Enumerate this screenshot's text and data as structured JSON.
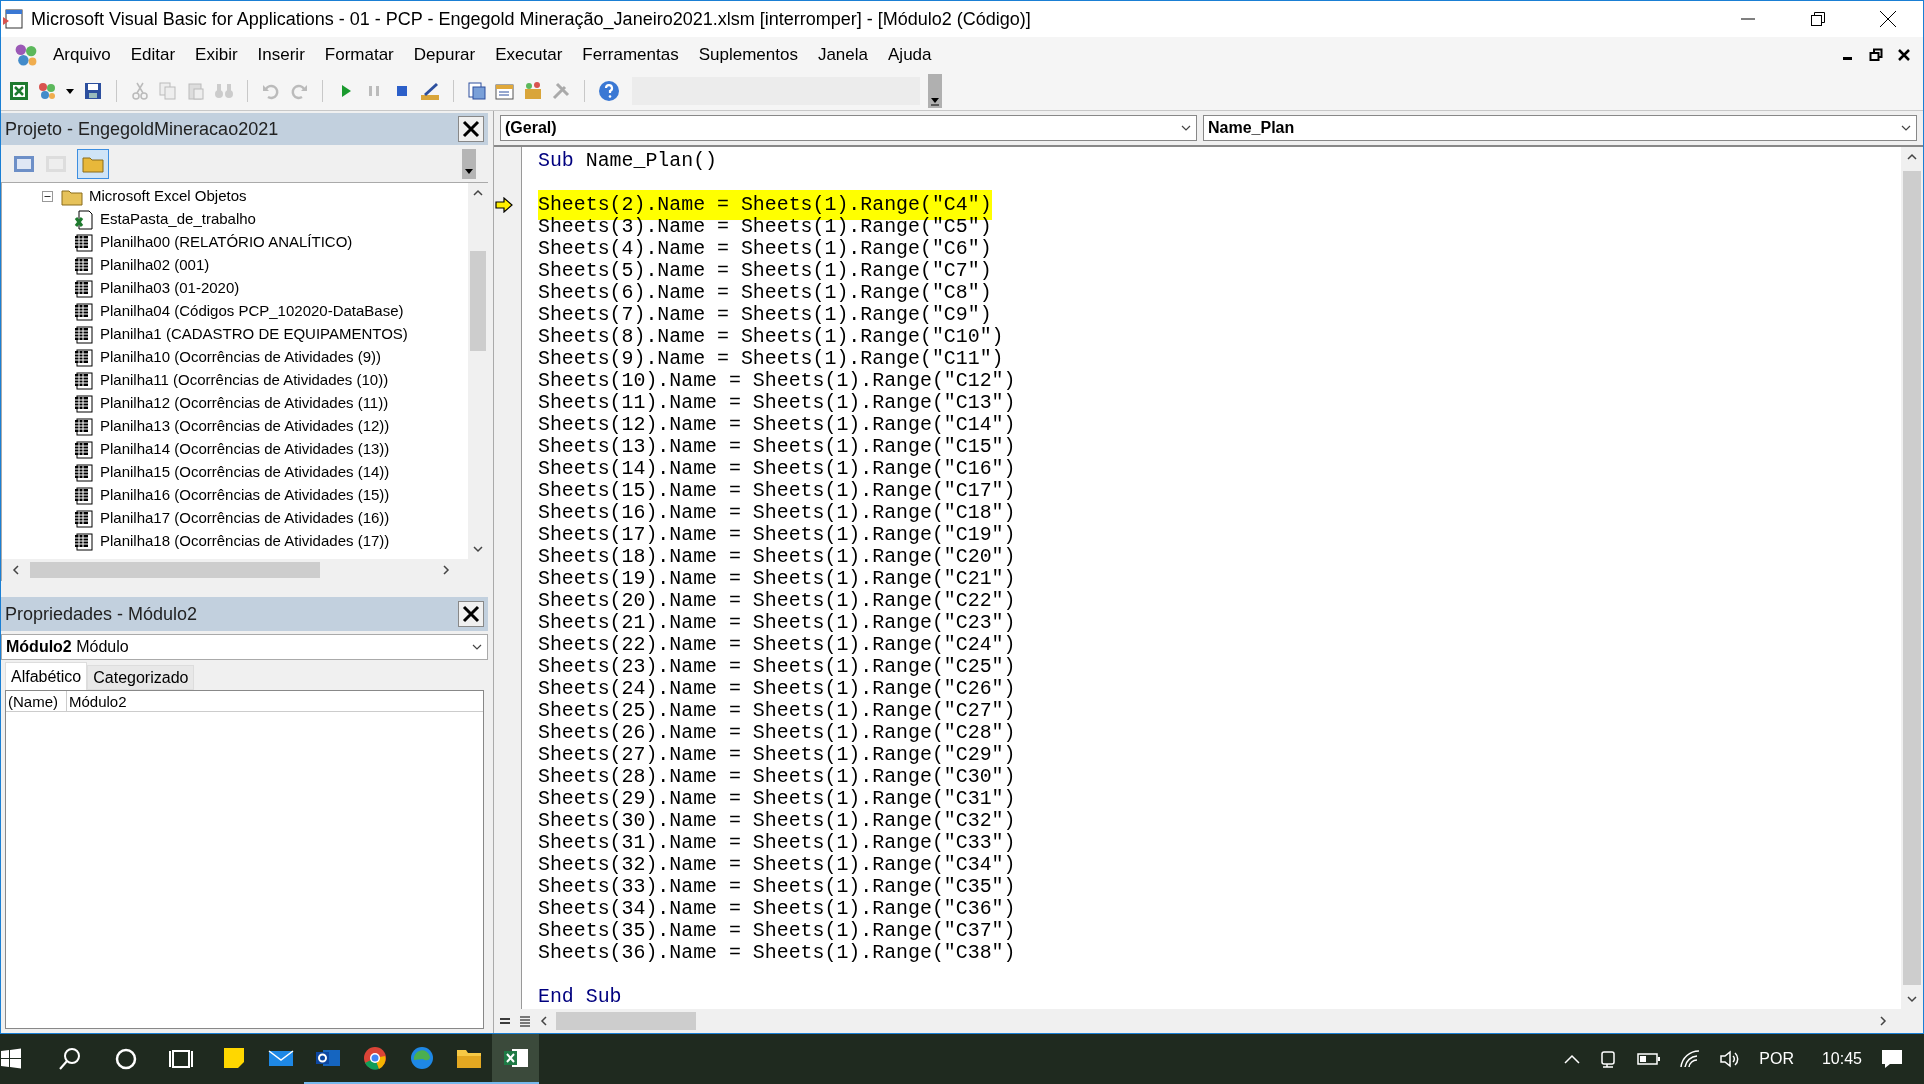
{
  "window": {
    "title": "Microsoft Visual Basic for Applications - 01 - PCP - Engegold Mineração_Janeiro2021.xlsm [interromper] - [Módulo2 (Código)]"
  },
  "menu": [
    "Arquivo",
    "Editar",
    "Exibir",
    "Inserir",
    "Formatar",
    "Depurar",
    "Executar",
    "Ferramentas",
    "Suplementos",
    "Janela",
    "Ajuda"
  ],
  "project": {
    "title": "Projeto - EngegoldMineracao2021",
    "tree": [
      {
        "label": "Microsoft Excel Objetos",
        "expanded": true,
        "children": [
          {
            "label": "EstaPasta_de_trabalho",
            "kind": "workbook"
          },
          {
            "label": "Planilha00 (RELATÓRIO ANALÍTICO)",
            "kind": "sheet"
          },
          {
            "label": "Planilha02 (001)",
            "kind": "sheet"
          },
          {
            "label": "Planilha03 (01-2020)",
            "kind": "sheet"
          },
          {
            "label": "Planilha04 (Códigos PCP_102020-DataBase)",
            "kind": "sheet"
          },
          {
            "label": "Planilha1 (CADASTRO DE EQUIPAMENTOS)",
            "kind": "sheet"
          },
          {
            "label": "Planilha10 (Ocorrências de Atividades (9))",
            "kind": "sheet"
          },
          {
            "label": "Planilha11 (Ocorrências de Atividades (10))",
            "kind": "sheet"
          },
          {
            "label": "Planilha12 (Ocorrências de Atividades (11))",
            "kind": "sheet"
          },
          {
            "label": "Planilha13 (Ocorrências de Atividades (12))",
            "kind": "sheet"
          },
          {
            "label": "Planilha14 (Ocorrências de Atividades (13))",
            "kind": "sheet"
          },
          {
            "label": "Planilha15 (Ocorrências de Atividades (14))",
            "kind": "sheet"
          },
          {
            "label": "Planilha16 (Ocorrências de Atividades (15))",
            "kind": "sheet"
          },
          {
            "label": "Planilha17 (Ocorrências de Atividades (16))",
            "kind": "sheet"
          },
          {
            "label": "Planilha18 (Ocorrências de Atividades (17))",
            "kind": "sheet"
          }
        ]
      }
    ]
  },
  "properties": {
    "title": "Propriedades - Módulo2",
    "object_name": "Módulo2",
    "object_type": "Módulo",
    "tabs": [
      {
        "label": "Alfabético",
        "selected": true
      },
      {
        "label": "Categorizado",
        "selected": false
      }
    ],
    "rows": [
      {
        "name": "(Name)",
        "value": "Módulo2"
      }
    ]
  },
  "code": {
    "object": "(Geral)",
    "procedure": "Name_Plan",
    "lines": [
      {
        "kind": "code",
        "keyword": "Sub",
        "text": "Name_Plan()",
        "current": false
      },
      {
        "kind": "blank"
      },
      {
        "kind": "code",
        "text": "Sheets(2).Name = Sheets(1).Range(\"C4\")",
        "current": true
      },
      {
        "kind": "code",
        "text": "Sheets(3).Name = Sheets(1).Range(\"C5\")",
        "current": false
      },
      {
        "kind": "code",
        "text": "Sheets(4).Name = Sheets(1).Range(\"C6\")",
        "current": false
      },
      {
        "kind": "code",
        "text": "Sheets(5).Name = Sheets(1).Range(\"C7\")",
        "current": false
      },
      {
        "kind": "code",
        "text": "Sheets(6).Name = Sheets(1).Range(\"C8\")",
        "current": false
      },
      {
        "kind": "code",
        "text": "Sheets(7).Name = Sheets(1).Range(\"C9\")",
        "current": false
      },
      {
        "kind": "code",
        "text": "Sheets(8).Name = Sheets(1).Range(\"C10\")",
        "current": false
      },
      {
        "kind": "code",
        "text": "Sheets(9).Name = Sheets(1).Range(\"C11\")",
        "current": false
      },
      {
        "kind": "code",
        "text": "Sheets(10).Name = Sheets(1).Range(\"C12\")",
        "current": false
      },
      {
        "kind": "code",
        "text": "Sheets(11).Name = Sheets(1).Range(\"C13\")",
        "current": false
      },
      {
        "kind": "code",
        "text": "Sheets(12).Name = Sheets(1).Range(\"C14\")",
        "current": false
      },
      {
        "kind": "code",
        "text": "Sheets(13).Name = Sheets(1).Range(\"C15\")",
        "current": false
      },
      {
        "kind": "code",
        "text": "Sheets(14).Name = Sheets(1).Range(\"C16\")",
        "current": false
      },
      {
        "kind": "code",
        "text": "Sheets(15).Name = Sheets(1).Range(\"C17\")",
        "current": false
      },
      {
        "kind": "code",
        "text": "Sheets(16).Name = Sheets(1).Range(\"C18\")",
        "current": false
      },
      {
        "kind": "code",
        "text": "Sheets(17).Name = Sheets(1).Range(\"C19\")",
        "current": false
      },
      {
        "kind": "code",
        "text": "Sheets(18).Name = Sheets(1).Range(\"C20\")",
        "current": false
      },
      {
        "kind": "code",
        "text": "Sheets(19).Name = Sheets(1).Range(\"C21\")",
        "current": false
      },
      {
        "kind": "code",
        "text": "Sheets(20).Name = Sheets(1).Range(\"C22\")",
        "current": false
      },
      {
        "kind": "code",
        "text": "Sheets(21).Name = Sheets(1).Range(\"C23\")",
        "current": false
      },
      {
        "kind": "code",
        "text": "Sheets(22).Name = Sheets(1).Range(\"C24\")",
        "current": false
      },
      {
        "kind": "code",
        "text": "Sheets(23).Name = Sheets(1).Range(\"C25\")",
        "current": false
      },
      {
        "kind": "code",
        "text": "Sheets(24).Name = Sheets(1).Range(\"C26\")",
        "current": false
      },
      {
        "kind": "code",
        "text": "Sheets(25).Name = Sheets(1).Range(\"C27\")",
        "current": false
      },
      {
        "kind": "code",
        "text": "Sheets(26).Name = Sheets(1).Range(\"C28\")",
        "current": false
      },
      {
        "kind": "code",
        "text": "Sheets(27).Name = Sheets(1).Range(\"C29\")",
        "current": false
      },
      {
        "kind": "code",
        "text": "Sheets(28).Name = Sheets(1).Range(\"C30\")",
        "current": false
      },
      {
        "kind": "code",
        "text": "Sheets(29).Name = Sheets(1).Range(\"C31\")",
        "current": false
      },
      {
        "kind": "code",
        "text": "Sheets(30).Name = Sheets(1).Range(\"C32\")",
        "current": false
      },
      {
        "kind": "code",
        "text": "Sheets(31).Name = Sheets(1).Range(\"C33\")",
        "current": false
      },
      {
        "kind": "code",
        "text": "Sheets(32).Name = Sheets(1).Range(\"C34\")",
        "current": false
      },
      {
        "kind": "code",
        "text": "Sheets(33).Name = Sheets(1).Range(\"C35\")",
        "current": false
      },
      {
        "kind": "code",
        "text": "Sheets(34).Name = Sheets(1).Range(\"C36\")",
        "current": false
      },
      {
        "kind": "code",
        "text": "Sheets(35).Name = Sheets(1).Range(\"C37\")",
        "current": false
      },
      {
        "kind": "code",
        "text": "Sheets(36).Name = Sheets(1).Range(\"C38\")",
        "current": false
      },
      {
        "kind": "blank"
      },
      {
        "kind": "code",
        "keyword": "End Sub",
        "current": false
      }
    ]
  },
  "taskbar": {
    "language": "POR",
    "time": "10:45"
  }
}
